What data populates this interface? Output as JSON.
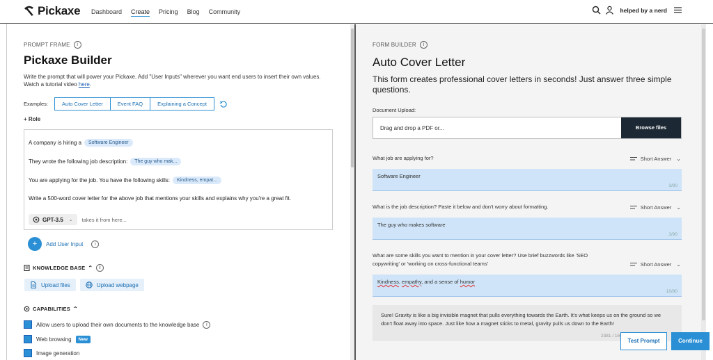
{
  "nav": {
    "logo": "Pickaxe",
    "links": [
      "Dashboard",
      "Create",
      "Pricing",
      "Blog",
      "Community"
    ],
    "active_link": "Create",
    "user": "helped by a nerd"
  },
  "left": {
    "section_label": "PROMPT FRAME",
    "title": "Pickaxe Builder",
    "description": "Write the prompt that will power your Pickaxe. Add \"User Inputs\" wherever you want end users to insert their own values. Watch a tutorial video ",
    "description_link": "here",
    "examples_label": "Examples:",
    "examples": [
      "Auto Cover Letter",
      "Event FAQ",
      "Explaining a Concept"
    ],
    "role": "+ Role",
    "prompt_lines": [
      {
        "text": "A company is hiring a",
        "chip": "Software Engineer"
      },
      {
        "text": "They wrote the following job description:",
        "chip": "The guy who mak..."
      },
      {
        "text": "You are applying for the job. You have the following skills:",
        "chip": "Kindness, empat..."
      },
      {
        "text": "Write a 500-word cover letter for the above job that mentions your skills and explains why you're a great fit.",
        "chip": ""
      }
    ],
    "model": "GPT-3.5",
    "model_hint": "takes it from here...",
    "add_user_input": "Add User Input",
    "knowledge_base": "KNOWLEDGE BASE",
    "upload_files": "Upload files",
    "upload_webpage": "Upload webpage",
    "capabilities": "CAPABILITIES",
    "cap_items": [
      {
        "label": "Allow users to upload their own documents to the knowledge base",
        "checked": true
      },
      {
        "label": "Web browsing",
        "badge": "New",
        "checked": true
      },
      {
        "label": "Image generation",
        "checked": true
      }
    ]
  },
  "right": {
    "section_label": "FORM BUILDER",
    "title": "Auto Cover Letter",
    "subtitle": "This form creates professional cover letters in seconds! Just answer three simple questions.",
    "doc_upload_label": "Document Upload:",
    "doc_placeholder": "Drag and drop a PDF or...",
    "browse_label": "Browse files",
    "questions": [
      {
        "label": "What job are applying for?",
        "type": "Short Answer",
        "value": "Software Engineer",
        "count": "3/90"
      },
      {
        "label": "What is the job description? Paste it below and don't worry about formatting.",
        "type": "Short Answer",
        "value": "The guy who makes software",
        "count": "3/90"
      },
      {
        "label": "What are some skills you want to mention in your cover letter? Use brief buzzwords like 'SEO copywriting' or 'working on cross-functional teams'",
        "type": "Short Answer",
        "value_parts": [
          "Kindness",
          ", ",
          "empathy",
          ", and a sense of ",
          "humor"
        ],
        "count": "10/90"
      }
    ],
    "output_text": "Sure! Gravity is like a big invisible magnet that pulls everything towards the Earth. It's what keeps us on the ground so we don't float away into space. Just like how a magnet sticks to metal, gravity pulls us down to the Earth!",
    "output_count": "2381 / 16000",
    "test_prompt": "Test Prompt",
    "continue": "Continue"
  }
}
